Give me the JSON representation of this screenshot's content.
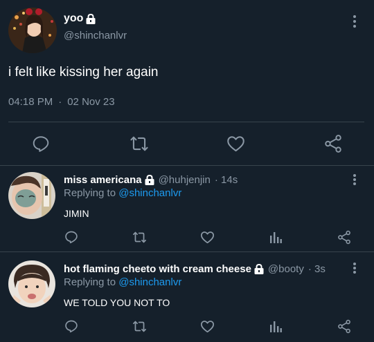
{
  "main_tweet": {
    "name": "yoo",
    "handle": "@shinchanlvr",
    "text": "i felt like kissing her again",
    "time": "04:18 PM",
    "separator": "·",
    "date": "02 Nov 23"
  },
  "replies": [
    {
      "name": "miss americana",
      "handle": "@huhjenjin",
      "age": "· 14s",
      "replying_prefix": "Replying to",
      "replying_to": "@shinchanlvr",
      "text": "JIMIN"
    },
    {
      "name": "hot flaming cheeto with cream cheese",
      "handle": "@booty",
      "age": "· 3s",
      "replying_prefix": "Replying to",
      "replying_to": "@shinchanlvr",
      "text": "WE TOLD YOU NOT TO"
    }
  ],
  "colors": {
    "background": "#15202b",
    "text": "#ffffff",
    "secondary": "#8b98a5",
    "mention": "#1d9bf0",
    "divider": "#38444d"
  },
  "icons": [
    "lock-icon",
    "more-icon",
    "reply-icon",
    "retweet-icon",
    "like-icon",
    "share-icon",
    "analytics-icon"
  ]
}
